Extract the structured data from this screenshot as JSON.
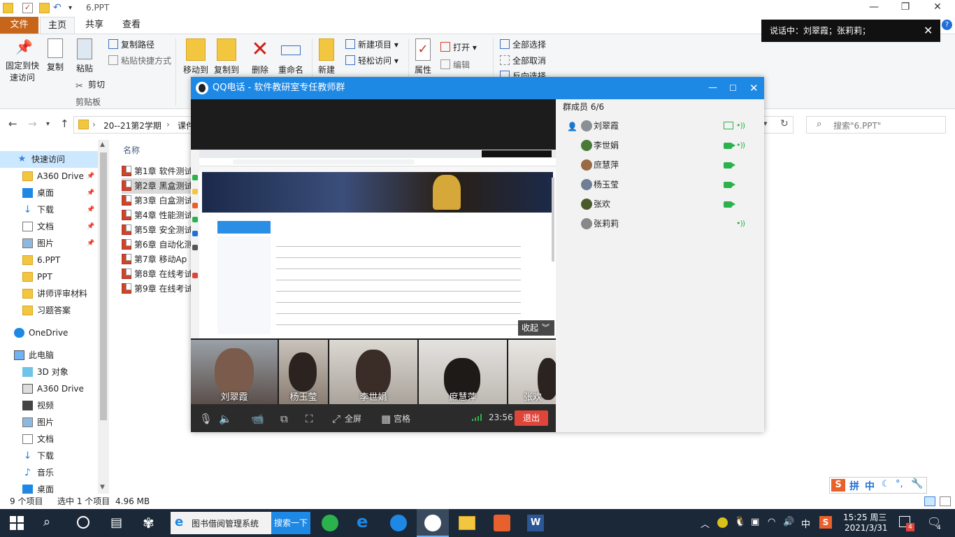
{
  "explorer": {
    "window_title": "6.PPT",
    "tabs": {
      "file": "文件",
      "home": "主页",
      "share": "共享",
      "view": "查看"
    },
    "ribbon": {
      "pin_quick_access": "固定到快速访问",
      "copy": "复制",
      "paste": "粘贴",
      "copy_path": "复制路径",
      "paste_shortcut": "粘贴快捷方式",
      "cut": "剪切",
      "clipboard_group": "剪贴板",
      "move_to": "移动到",
      "copy_to": "复制到",
      "delete": "删除",
      "rename": "重命名",
      "new_folder": "新建",
      "new_item": "新建项目",
      "easy_access": "轻松访问",
      "properties": "属性",
      "open": "打开",
      "edit": "编辑",
      "select_all": "全部选择",
      "select_none": "全部取消",
      "invert_selection": "反向选择"
    },
    "address": {
      "path_1": "20--21第2学期",
      "path_2": "课件",
      "separator": "›"
    },
    "search_placeholder": "搜索\"6.PPT\"",
    "nav_pane": [
      {
        "label": "快速访问",
        "icon": "star-icon",
        "pinned": false
      },
      {
        "label": "A360 Drive",
        "icon": "folder-icon",
        "pinned": true
      },
      {
        "label": "桌面",
        "icon": "desktop-icon",
        "pinned": true
      },
      {
        "label": "下载",
        "icon": "download-icon",
        "pinned": true
      },
      {
        "label": "文档",
        "icon": "document-icon",
        "pinned": true
      },
      {
        "label": "图片",
        "icon": "picture-icon",
        "pinned": true
      },
      {
        "label": "6.PPT",
        "icon": "folder-icon",
        "pinned": false
      },
      {
        "label": "PPT",
        "icon": "folder-icon",
        "pinned": false
      },
      {
        "label": "讲师评审材料",
        "icon": "folder-icon",
        "pinned": false
      },
      {
        "label": "习题答案",
        "icon": "folder-icon",
        "pinned": false
      },
      {
        "label": "OneDrive",
        "icon": "cloud-icon",
        "pinned": false
      },
      {
        "label": "此电脑",
        "icon": "computer-icon",
        "pinned": false
      },
      {
        "label": "3D 对象",
        "icon": "cube-icon",
        "pinned": false
      },
      {
        "label": "A360 Drive",
        "icon": "drive-icon",
        "pinned": false
      },
      {
        "label": "视频",
        "icon": "video-icon",
        "pinned": false
      },
      {
        "label": "图片",
        "icon": "picture-icon",
        "pinned": false
      },
      {
        "label": "文档",
        "icon": "document-icon",
        "pinned": false
      },
      {
        "label": "下载",
        "icon": "download-icon",
        "pinned": false
      },
      {
        "label": "音乐",
        "icon": "music-icon",
        "pinned": false
      },
      {
        "label": "桌面",
        "icon": "desktop-icon",
        "pinned": false
      }
    ],
    "pin_glyph": "📌",
    "column_name": "名称",
    "files": [
      "第1章 软件测试",
      "第2章 黑盒测试",
      "第3章 白盒测试",
      "第4章 性能测试",
      "第5章 安全测试",
      "第6章 自动化测",
      "第7章 移动Ap",
      "第8章 在线考试",
      "第9章 在线考试"
    ],
    "status": {
      "count": "9 个项目",
      "selected": "选中 1 个项目",
      "size": "4.96 MB"
    }
  },
  "qq_call": {
    "title": "QQ电话 - 软件教研室专任教师群",
    "collapse": "收起",
    "participants": [
      "刘翠霞",
      "杨玉莹",
      "李世娟",
      "庶慧萍",
      "张欢"
    ],
    "controls": {
      "fullscreen": "全屏",
      "grid": "宫格",
      "timer": "23:56",
      "exit": "退出"
    },
    "members_header": "群成员 6/6",
    "members": [
      {
        "name": "刘翠霞",
        "camera": false,
        "screen": true,
        "speaking": true
      },
      {
        "name": "李世娟",
        "camera": true,
        "screen": false,
        "speaking": true
      },
      {
        "name": "庶慧萍",
        "camera": true,
        "screen": false,
        "speaking": false
      },
      {
        "name": "杨玉莹",
        "camera": true,
        "screen": false,
        "speaking": false
      },
      {
        "name": "张欢",
        "camera": true,
        "screen": false,
        "speaking": false
      },
      {
        "name": "张莉莉",
        "camera": false,
        "screen": false,
        "speaking": true
      }
    ]
  },
  "talking_tip": "说话中：刘翠霞；张莉莉；",
  "ime": {
    "mode": "拼",
    "lang": "中"
  },
  "taskbar": {
    "app_ie": "图书借阅管理系统",
    "search_button": "搜索一下",
    "tray_lang": "中",
    "clock_time": "15:25 周三",
    "clock_date": "2021/3/31",
    "notify_count": "4",
    "action_center_count": "4"
  },
  "colors": {
    "qq_title": "#1e88e5",
    "file_tab": "#c7651a",
    "exit_button": "#e0453a",
    "speaking_green": "#2bb24c",
    "taskbar": "#1b2838"
  }
}
